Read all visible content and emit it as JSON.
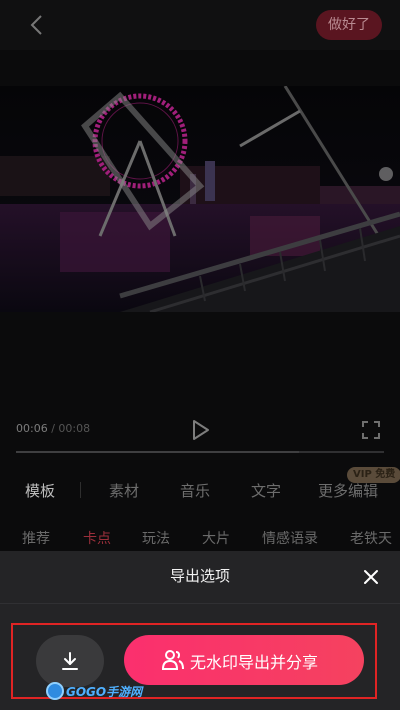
{
  "header": {
    "done_label": "做好了"
  },
  "player": {
    "current_time": "00:06",
    "separator": " / ",
    "total_time": "00:08",
    "progress": 0.77
  },
  "tabs": {
    "items": [
      "模板",
      "素材",
      "音乐",
      "文字",
      "更多编辑"
    ],
    "active_index": 0,
    "vip_badge": "VIP 免费"
  },
  "subtabs": {
    "items": [
      "推荐",
      "卡点",
      "玩法",
      "大片",
      "情感语录",
      "老铁天"
    ],
    "active_index": 1
  },
  "export_sheet": {
    "title": "导出选项",
    "export_button_label": "无水印导出并分享"
  },
  "watermark": {
    "text": "GOGO手游网"
  },
  "colors": {
    "accent": "#fb2f6e",
    "highlight_border": "#e02424",
    "sheet_bg": "#242426"
  },
  "icons": {
    "back": "chevron-left-icon",
    "play": "play-icon",
    "fullscreen": "fullscreen-icon",
    "close": "close-icon",
    "download": "download-icon",
    "share": "share-people-icon"
  }
}
